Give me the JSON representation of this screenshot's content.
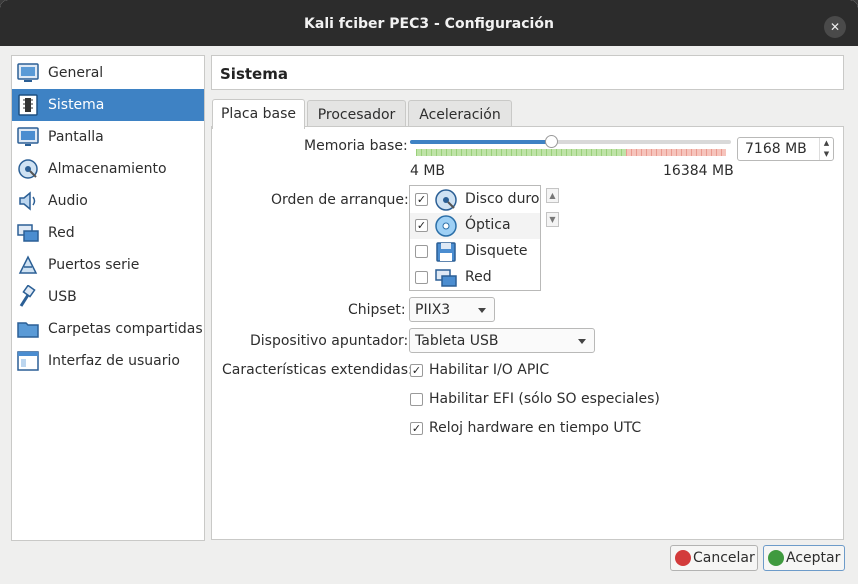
{
  "window": {
    "title": "Kali fciber PEC3 - Configuración",
    "close_glyph": "✕"
  },
  "sidebar": {
    "items": [
      {
        "label": "General",
        "icon": "general-icon",
        "selected": false
      },
      {
        "label": "Sistema",
        "icon": "system-icon",
        "selected": true
      },
      {
        "label": "Pantalla",
        "icon": "display-icon",
        "selected": false
      },
      {
        "label": "Almacenamiento",
        "icon": "storage-icon",
        "selected": false
      },
      {
        "label": "Audio",
        "icon": "audio-icon",
        "selected": false
      },
      {
        "label": "Red",
        "icon": "network-icon",
        "selected": false
      },
      {
        "label": "Puertos serie",
        "icon": "serial-ports-icon",
        "selected": false
      },
      {
        "label": "USB",
        "icon": "usb-icon",
        "selected": false
      },
      {
        "label": "Carpetas compartidas",
        "icon": "shared-folders-icon",
        "selected": false
      },
      {
        "label": "Interfaz de usuario",
        "icon": "user-interface-icon",
        "selected": false
      }
    ]
  },
  "header": {
    "title": "Sistema"
  },
  "tabs": [
    {
      "label": "Placa base",
      "active": true
    },
    {
      "label": "Procesador",
      "active": false
    },
    {
      "label": "Aceleración",
      "active": false
    }
  ],
  "memory": {
    "label": "Memoria base:",
    "value": "7168 MB",
    "min_label": "4 MB",
    "max_label": "16384 MB",
    "slider_value_mb": 7168,
    "slider_min_mb": 4,
    "slider_max_mb": 16384
  },
  "boot_order": {
    "label": "Orden de arranque:",
    "items": [
      {
        "label": "Disco duro",
        "checked": true,
        "icon": "hard-disk-icon"
      },
      {
        "label": "Óptica",
        "checked": true,
        "icon": "optical-disc-icon"
      },
      {
        "label": "Disquete",
        "checked": false,
        "icon": "floppy-icon"
      },
      {
        "label": "Red",
        "checked": false,
        "icon": "network-boot-icon"
      }
    ]
  },
  "chipset": {
    "label": "Chipset:",
    "value": "PIIX3"
  },
  "pointing_device": {
    "label": "Dispositivo apuntador:",
    "value": "Tableta USB"
  },
  "extended": {
    "label": "Características extendidas:",
    "options": [
      {
        "label": "Habilitar I/O APIC",
        "checked": true
      },
      {
        "label": "Habilitar EFI (sólo SO especiales)",
        "checked": false
      },
      {
        "label": "Reloj hardware en tiempo UTC",
        "checked": true
      }
    ]
  },
  "buttons": {
    "cancel": "Cancelar",
    "ok": "Aceptar"
  },
  "colors": {
    "accent": "#3e82c4",
    "titlebar": "#2c2c2c",
    "window_bg": "#efefee"
  }
}
